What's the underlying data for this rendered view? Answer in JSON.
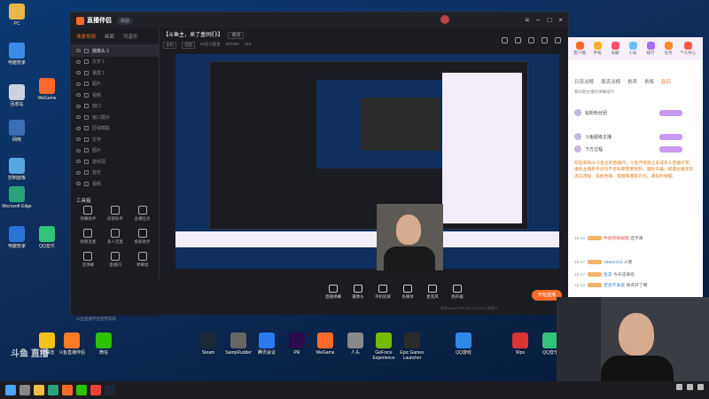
{
  "app": {
    "brand": "直播伴侣",
    "version": "体验",
    "stream_title": "【斗鱼主，来了盒同们!】",
    "edit_link": "修改",
    "meta": [
      "主机",
      "电脑",
      "dx化斗鱼主",
      "107054",
      "412"
    ],
    "scene_tabs": [
      "场景视频",
      "画面",
      "可音乐"
    ],
    "sources": [
      "摄像头 1",
      "文字 1",
      "录屏 1",
      "图片",
      "视频",
      "窗口",
      "窗口展示",
      "区域截取",
      "文字",
      "图片",
      "游戏源",
      "音乐",
      "视频"
    ],
    "toolbox_title": "工具箱",
    "tools": [
      "弹幕助手",
      "房管助手",
      "主播任务",
      "视频连麦",
      "多人连麦",
      "搜索助手",
      "连弹幕",
      "直播间",
      "弹幕墙"
    ],
    "more_hint": "斗鱼直播伴侣使用帮助",
    "controls": [
      "直播弹幕",
      "摄像头",
      "手机投屏",
      "多媒体",
      "麦克风",
      "扬声器"
    ],
    "live_button": "开始直播",
    "stats": "码率:0kb/s  FPS:30  CPU:12%  丢帧:0"
  },
  "chat": {
    "top_buttons": [
      "客户端",
      "手机",
      "贡献",
      "小号",
      "排行",
      "任务",
      "个人中心"
    ],
    "tabs": [
      "日流派榜",
      "周流派榜",
      "贵宾",
      "贵族",
      "钻石",
      "钻粉"
    ],
    "guard_row": "我同期主播的弹幕排行",
    "ranking": [
      "钻粉粉丝团",
      "斗鱼超级主播",
      "下方过程"
    ],
    "welcome": "欢迎来到dx斗鱼主的直播间。斗鱼严厉禁止未成年人直播打赏，虚拟主播和平台均不会私聊索要钱财，谨防诈骗。如遇主播涉及违法违规、低俗色情、吸烟喝酒等行为，请及时举报。",
    "messages": [
      {
        "time": "18:16",
        "nick": "牛皮的蚂蚁呀",
        "text": "还不来"
      },
      {
        "time": "18:17",
        "nick": "16554743",
        "text": "人呢"
      },
      {
        "time": "18:17",
        "nick": "鱼友",
        "text": "今天还来吗"
      },
      {
        "time": "18:18",
        "nick": "老虎不发威",
        "text": "快点开了啊"
      }
    ]
  },
  "desktop": {
    "icons": [
      "PC",
      "电脑管家",
      "回收站",
      "网络",
      "控制面板",
      "Microsoft Edge",
      "电脑管家",
      "QQ音乐",
      "WeGame",
      "YY语音",
      "斗鱼直播伴侣",
      "微信",
      "Steam",
      "SampRudder",
      "腾讯会议",
      "PR",
      "WeGame",
      "人头",
      "GeForce Experience",
      "Epic Games Launcher",
      "QQ游戏",
      "Wps",
      "QQ音乐"
    ]
  },
  "watermark": "斗鱼 直播"
}
